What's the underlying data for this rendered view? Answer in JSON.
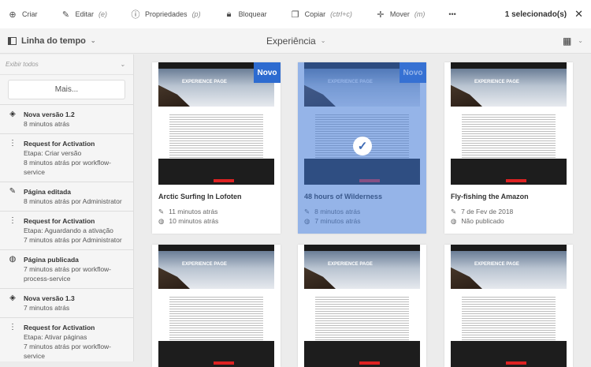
{
  "toolbar": {
    "items": [
      {
        "label": "Criar",
        "shortcut": "",
        "icon": "plus-circle-icon"
      },
      {
        "label": "Editar",
        "shortcut": "(e)",
        "icon": "pencil-icon"
      },
      {
        "label": "Propriedades",
        "shortcut": "(p)",
        "icon": "info-icon"
      },
      {
        "label": "Bloquear",
        "shortcut": "",
        "icon": "lock-icon"
      },
      {
        "label": "Copiar",
        "shortcut": "(ctrl+c)",
        "icon": "copy-icon"
      },
      {
        "label": "Mover",
        "shortcut": "(m)",
        "icon": "move-icon"
      }
    ],
    "more": "•••",
    "selection": "1 selecionado(s)"
  },
  "rail": {
    "label": "Linha do tempo"
  },
  "header": {
    "title": "Experiência"
  },
  "sidebar": {
    "filter": "Exibir todos",
    "more_button": "Mais...",
    "items": [
      {
        "icon": "layers-icon",
        "title": "Nova versão 1.2",
        "lines": [
          "8 minutos atrás"
        ]
      },
      {
        "icon": "workflow-icon",
        "title": "Request for Activation",
        "lines": [
          "Etapa: Criar versão",
          "8 minutos atrás por workflow-service"
        ]
      },
      {
        "icon": "pencil-icon",
        "title": "Página editada",
        "lines": [
          "8 minutos atrás por Administrator"
        ]
      },
      {
        "icon": "workflow-icon",
        "title": "Request for Activation",
        "lines": [
          "Etapa: Aguardando a ativação",
          "7 minutos atrás por Administrator"
        ]
      },
      {
        "icon": "globe-icon",
        "title": "Página publicada",
        "lines": [
          "7 minutos atrás por workflow-process-service"
        ]
      },
      {
        "icon": "layers-icon",
        "title": "Nova versão 1.3",
        "lines": [
          "7 minutos atrás"
        ]
      },
      {
        "icon": "workflow-icon",
        "title": "Request for Activation",
        "lines": [
          "Etapa: Ativar páginas",
          "7 minutos atrás por workflow-service"
        ]
      }
    ]
  },
  "cards": [
    {
      "title": "Arctic Surfing In Lofoten",
      "modified": "11 minutos atrás",
      "published": "10 minutos atrás",
      "badge": "Novo",
      "thumb_text": "EXPERIENCE PAGE",
      "selected": false
    },
    {
      "title": "48 hours of Wilderness",
      "modified": "8 minutos atrás",
      "published": "7 minutos atrás",
      "badge": "Novo",
      "thumb_text": "EXPERIENCE PAGE",
      "selected": true
    },
    {
      "title": "Fly-fishing the Amazon",
      "modified": "7 de Fev de 2018",
      "published": "Não publicado",
      "badge": "",
      "thumb_text": "EXPERIENCE PAGE",
      "selected": false
    },
    {
      "thumb_text": "EXPERIENCE PAGE"
    },
    {
      "thumb_text": "EXPERIENCE PAGE"
    },
    {
      "thumb_text": "EXPERIENCE PAGE"
    }
  ],
  "colors": {
    "accent": "#2d6bd0",
    "selection": "#3e76d6"
  }
}
